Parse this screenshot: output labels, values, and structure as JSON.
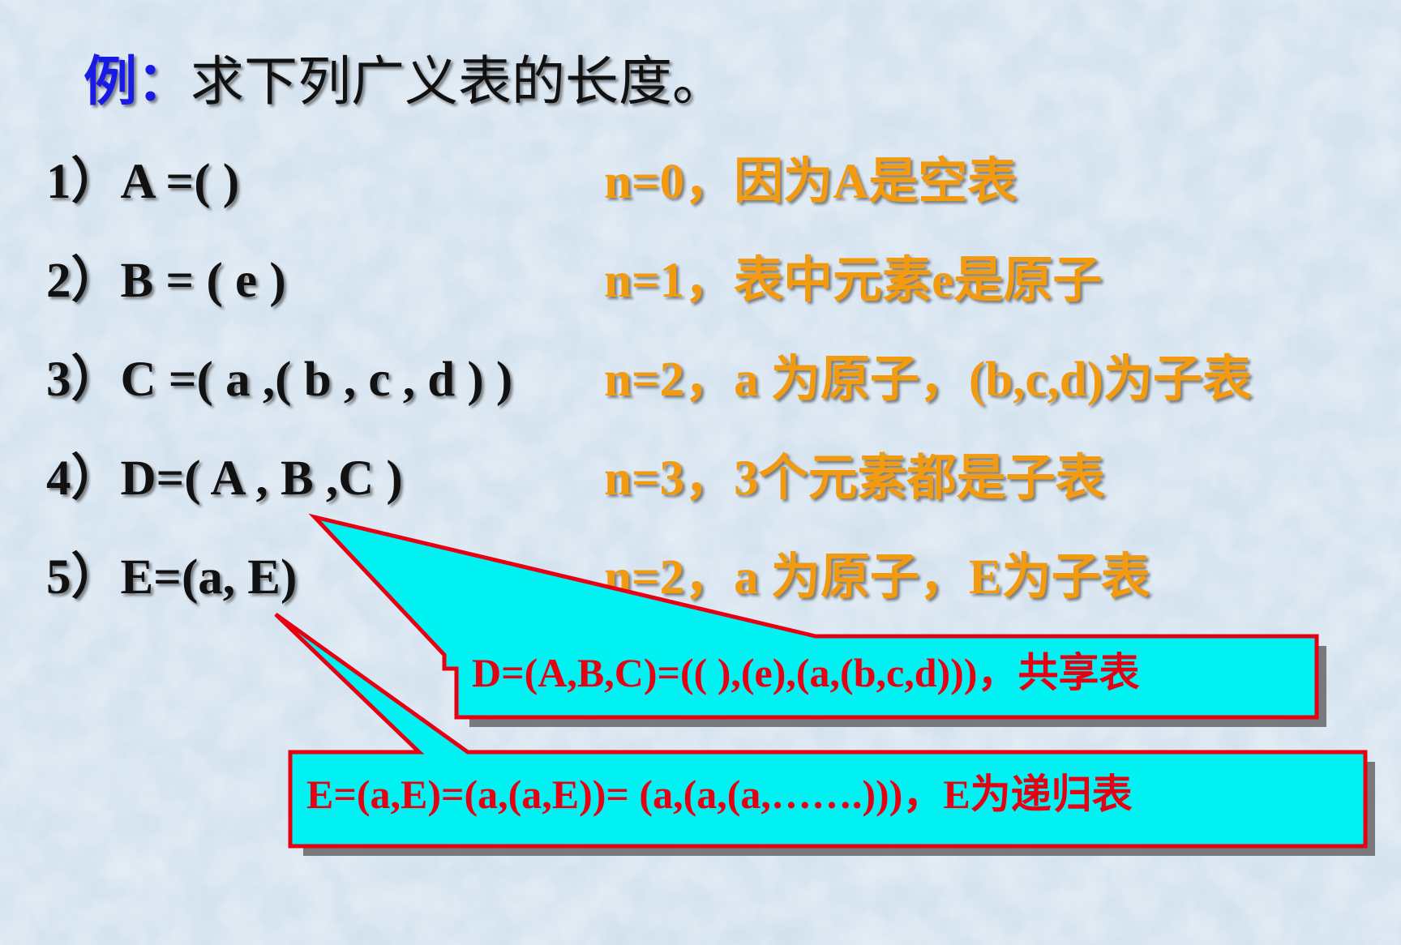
{
  "title": {
    "lead": "例：",
    "text": "求下列广义表的长度。"
  },
  "items": [
    {
      "label": "1）A =( )",
      "answer": "n=0，因为A是空表"
    },
    {
      "label": "2）B = ( e )",
      "answer": "n=1，表中元素e是原子"
    },
    {
      "label": "3）C =( a ,( b , c , d ) )",
      "answer": "n=2，a 为原子，(b,c,d)为子表"
    },
    {
      "label": "4）D=( A , B ,C )",
      "answer": "n=3，3个元素都是子表"
    },
    {
      "label": "5）E=(a, E)",
      "answer": "n=2，a 为原子，E为子表"
    }
  ],
  "callouts": [
    {
      "name": "shared-list",
      "text": "D=(A,B,C)=(( ),(e),(a,(b,c,d)))，共享表"
    },
    {
      "name": "recursive-list",
      "text": "E=(a,E)=(a,(a,E))= (a,(a,(a,…….)))，E为递归表"
    }
  ],
  "colors": {
    "background": "#d2e2ef",
    "lead": "#1a1ae6",
    "body_text": "#111111",
    "answer": "#f29a10",
    "callout_fill": "#00f2f2",
    "callout_border": "#e60012",
    "callout_text": "#e60012"
  }
}
